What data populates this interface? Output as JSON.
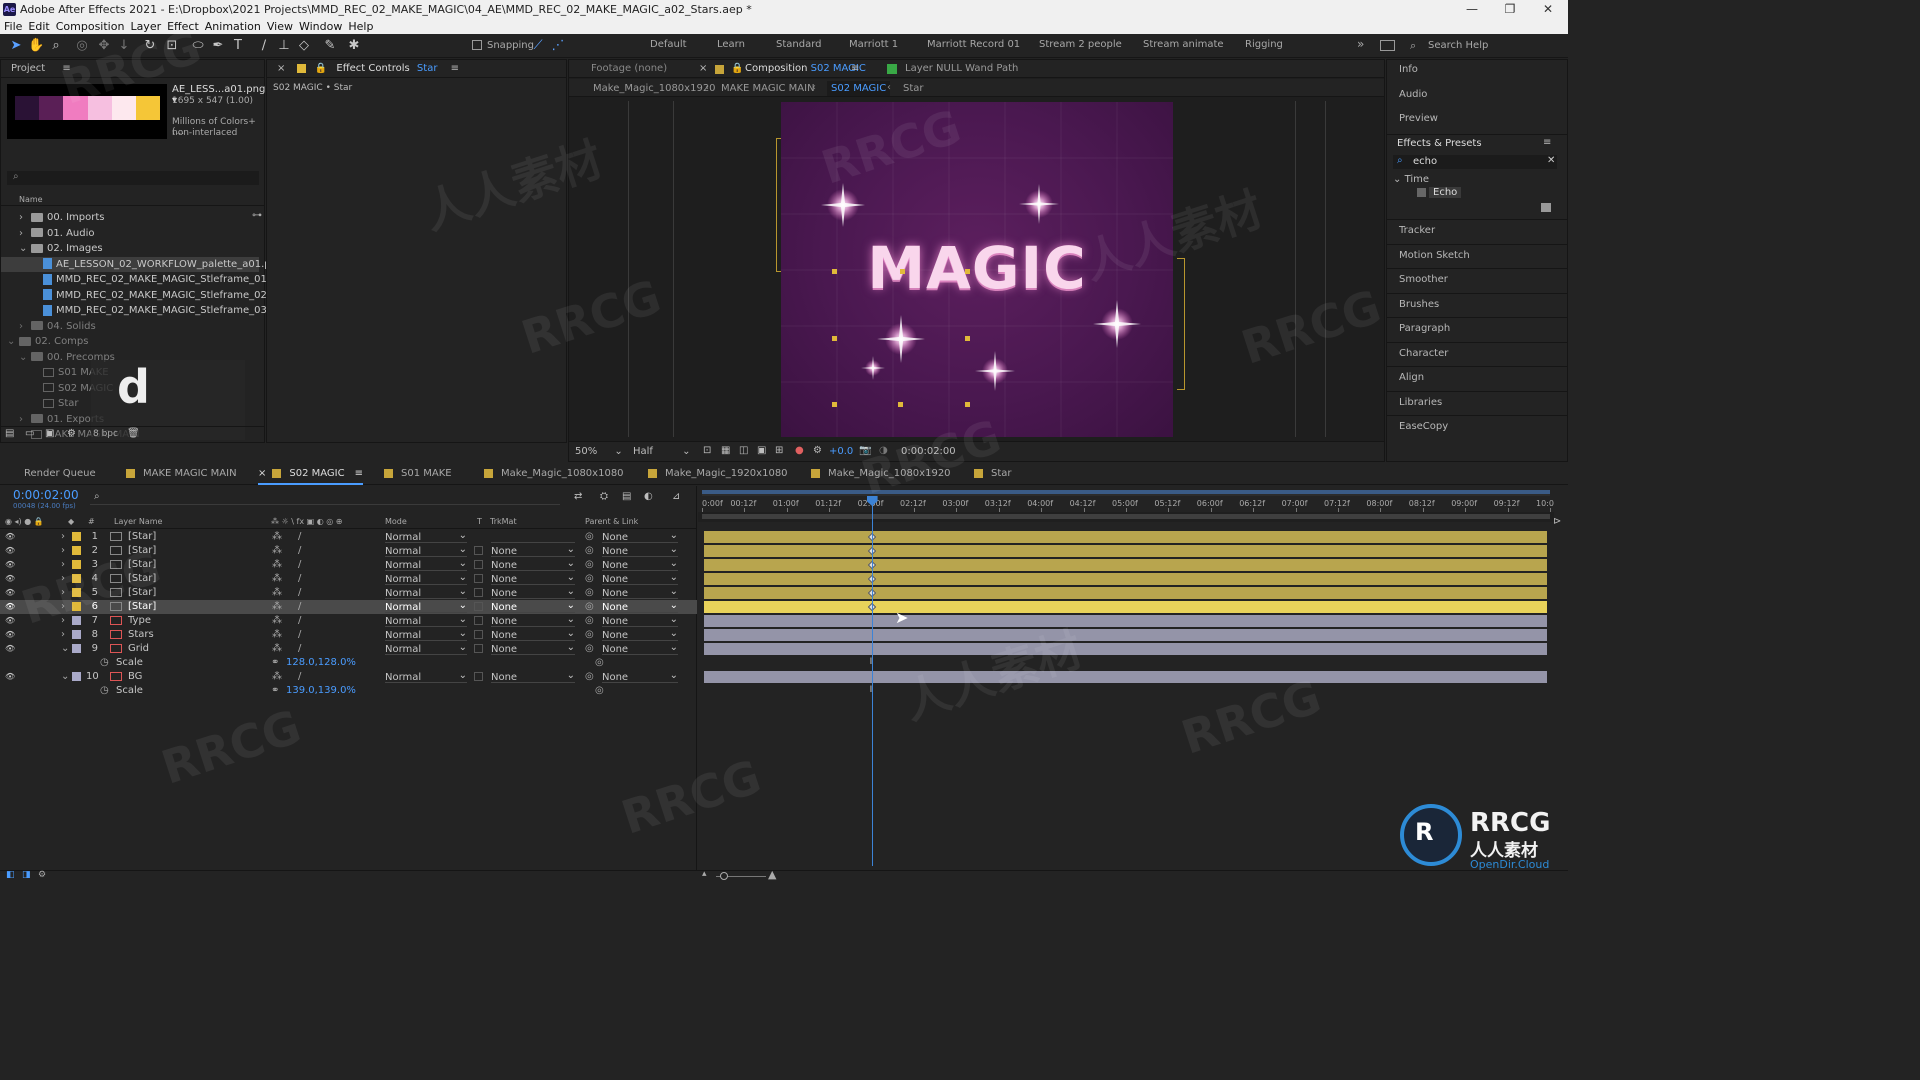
{
  "window": {
    "app_icon": "Ae",
    "title": "Adobe After Effects 2021 - E:\\Dropbox\\2021 Projects\\MMD_REC_02_MAKE_MAGIC\\04_AE\\MMD_REC_02_MAKE_MAGIC_a02_Stars.aep *",
    "minimize": "—",
    "maximize": "❐",
    "close": "✕"
  },
  "menu": [
    "File",
    "Edit",
    "Composition",
    "Layer",
    "Effect",
    "Animation",
    "View",
    "Window",
    "Help"
  ],
  "toolbar": {
    "snapping_label": "Snapping",
    "workspaces": [
      "Default",
      "Learn",
      "Standard",
      "Marriott 1",
      "Marriott Record 01",
      "Stream 2 people",
      "Stream animate",
      "Rigging"
    ],
    "more": "»",
    "search_placeholder": "Search Help"
  },
  "project": {
    "title": "Project",
    "preview_name": "AE_LESS...a01.png ▾",
    "preview_dims": "1695 x 547 (1.00)",
    "preview_info1": "Millions of Colors+ (...",
    "preview_info2": "non-interlaced",
    "palette": [
      "#2a1235",
      "#5a1f56",
      "#f07cc0",
      "#f6bfe0",
      "#fde8ee",
      "#f5c637"
    ],
    "name_col": "Name",
    "items": [
      {
        "label": "00. Imports",
        "type": "folder",
        "indent": 1,
        "arrow": "›"
      },
      {
        "label": "01. Audio",
        "type": "folder",
        "indent": 1,
        "arrow": "›"
      },
      {
        "label": "02. Images",
        "type": "folder",
        "indent": 1,
        "arrow": "⌄"
      },
      {
        "label": "AE_LESSON_02_WORKFLOW_palette_a01.png",
        "type": "file",
        "indent": 2,
        "arrow": ""
      },
      {
        "label": "MMD_REC_02_MAKE_MAGIC_Stleframe_01.jpg",
        "type": "file",
        "indent": 2,
        "arrow": ""
      },
      {
        "label": "MMD_REC_02_MAKE_MAGIC_Stleframe_02.jpg",
        "type": "file",
        "indent": 2,
        "arrow": ""
      },
      {
        "label": "MMD_REC_02_MAKE_MAGIC_Stleframe_03.jpg",
        "type": "file",
        "indent": 2,
        "arrow": ""
      },
      {
        "label": "04. Solids",
        "type": "folder",
        "indent": 1,
        "arrow": "›"
      },
      {
        "label": "02. Comps",
        "type": "folder",
        "indent": 0,
        "arrow": "⌄"
      },
      {
        "label": "00. Precomps",
        "type": "folder",
        "indent": 1,
        "arrow": "⌄"
      },
      {
        "label": "S01 MAKE",
        "type": "comp",
        "indent": 2,
        "arrow": ""
      },
      {
        "label": "S02 MAGIC",
        "type": "comp",
        "indent": 2,
        "arrow": ""
      },
      {
        "label": "Star",
        "type": "comp",
        "indent": 2,
        "arrow": ""
      },
      {
        "label": "01. Exports",
        "type": "folder",
        "indent": 1,
        "arrow": "›"
      },
      {
        "label": "MAKE MAGIC MAIN",
        "type": "comp",
        "indent": 1,
        "arrow": ""
      }
    ],
    "key_overlay": "d",
    "bpc": "8 bpc"
  },
  "effect_controls": {
    "title": "Effect Controls",
    "layer": "Star",
    "path": "S02 MAGIC • Star"
  },
  "viewer": {
    "footage_tab": "Footage (none)",
    "comp_tab_prefix": "Composition",
    "comp_tab_name": "S02 MAGIC",
    "layer_tab": "Layer  NULL Wand Path",
    "crumbs": [
      "Make_Magic_1080x1920",
      "MAKE MAGIC MAIN",
      "S02 MAGIC",
      "Star"
    ],
    "magic_text": "MAGIC",
    "zoom": "50%",
    "resolution": "Half",
    "exposure": "+0.0",
    "timecode": "0:00:02:00"
  },
  "right_panel": {
    "items_top": [
      "Info",
      "Audio",
      "Preview"
    ],
    "effects_title": "Effects & Presets",
    "search_value": "echo",
    "category": "Time",
    "effect": "Echo",
    "items_bottom": [
      "Tracker",
      "Motion Sketch",
      "Smoother",
      "Brushes",
      "Paragraph",
      "Character",
      "Align",
      "Libraries",
      "EaseCopy"
    ]
  },
  "timeline": {
    "tabs": [
      {
        "label": "Render Queue",
        "color": ""
      },
      {
        "label": "MAKE MAGIC MAIN",
        "color": "#c7a53a"
      },
      {
        "label": "S02 MAGIC",
        "color": "#c7a53a"
      },
      {
        "label": "S01 MAKE",
        "color": "#c7a53a"
      },
      {
        "label": "Make_Magic_1080x1080",
        "color": "#c7a53a"
      },
      {
        "label": "Make_Magic_1920x1080",
        "color": "#c7a53a"
      },
      {
        "label": "Make_Magic_1080x1920",
        "color": "#c7a53a"
      },
      {
        "label": "Star",
        "color": "#c7a53a"
      }
    ],
    "timecode": "0:00:02:00",
    "frame_info": "00048 (24.00 fps)",
    "col_layer_name": "Layer Name",
    "col_mode": "Mode",
    "col_t": "T",
    "col_trkmat": "TrkMat",
    "col_parent": "Parent & Link",
    "ruler": [
      "0:00f",
      "00:12f",
      "01:00f",
      "01:12f",
      "02:00f",
      "02:12f",
      "03:00f",
      "03:12f",
      "04:00f",
      "04:12f",
      "05:00f",
      "05:12f",
      "06:00f",
      "06:12f",
      "07:00f",
      "07:12f",
      "08:00f",
      "08:12f",
      "09:00f",
      "09:12f",
      "10:0"
    ],
    "current_time_fraction": 0.2,
    "layers": [
      {
        "num": "1",
        "name": "[Star]",
        "color": "#e0b93a",
        "mode": "Normal",
        "trkmat": "",
        "parent": "None",
        "bar": "#b8a54e"
      },
      {
        "num": "2",
        "name": "[Star]",
        "color": "#e0b93a",
        "mode": "Normal",
        "trkmat": "None",
        "parent": "None",
        "bar": "#b8a54e"
      },
      {
        "num": "3",
        "name": "[Star]",
        "color": "#e0b93a",
        "mode": "Normal",
        "trkmat": "None",
        "parent": "None",
        "bar": "#b8a54e"
      },
      {
        "num": "4",
        "name": "[Star]",
        "color": "#e0b93a",
        "mode": "Normal",
        "trkmat": "None",
        "parent": "None",
        "bar": "#b8a54e"
      },
      {
        "num": "5",
        "name": "[Star]",
        "color": "#e0b93a",
        "mode": "Normal",
        "trkmat": "None",
        "parent": "None",
        "bar": "#b8a54e"
      },
      {
        "num": "6",
        "name": "[Star]",
        "color": "#e0b93a",
        "mode": "Normal",
        "trkmat": "None",
        "parent": "None",
        "bar": "#e8d25a"
      },
      {
        "num": "7",
        "name": "Type",
        "color": "#a9a9c8",
        "mode": "Normal",
        "trkmat": "None",
        "parent": "None",
        "bar": "#9494a8"
      },
      {
        "num": "8",
        "name": "Stars",
        "color": "#a9a9c8",
        "mode": "Normal",
        "trkmat": "None",
        "parent": "None",
        "bar": "#9494a8"
      },
      {
        "num": "9",
        "name": "Grid",
        "color": "#a9a9c8",
        "mode": "Normal",
        "trkmat": "None",
        "parent": "None",
        "bar": "#9494a8"
      },
      {
        "num": "10",
        "name": "BG",
        "color": "#a9a9c8",
        "mode": "Normal",
        "trkmat": "None",
        "parent": "None",
        "bar": "#9494a8"
      }
    ],
    "grid_scale": {
      "label": "Scale",
      "value": "128.0,128.0%"
    },
    "bg_scale": {
      "label": "Scale",
      "value": "139.0,139.0%"
    }
  },
  "watermark": {
    "text": "RRCG",
    "cn": "人人素材",
    "logo_en": "RRCG",
    "logo_cn": "人人素材",
    "logo_sub": "OpenDir.Cloud"
  }
}
